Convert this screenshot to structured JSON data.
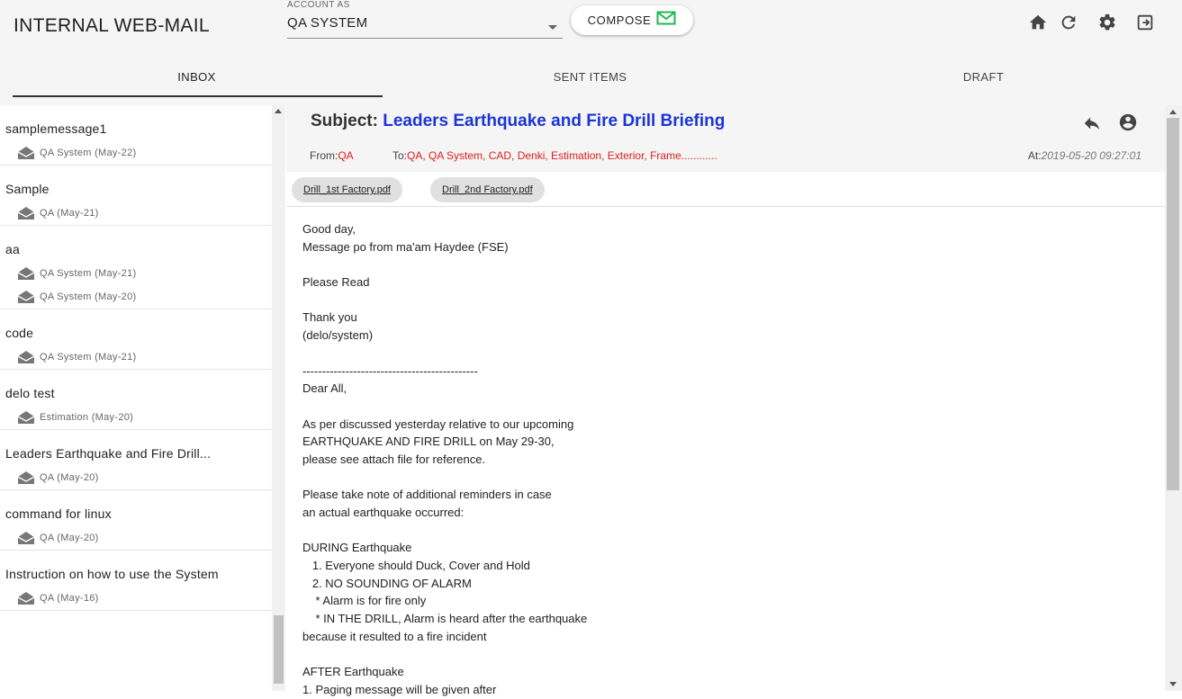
{
  "app": {
    "title": "INTERNAL WEB-MAIL"
  },
  "account": {
    "label": "ACCOUNT AS",
    "value": "QA SYSTEM"
  },
  "compose": {
    "label": "COMPOSE"
  },
  "toolbar_icons": [
    "home-icon",
    "refresh-icon",
    "settings-icon",
    "logout-icon"
  ],
  "tabs": [
    {
      "label": "INBOX",
      "active": true
    },
    {
      "label": "SENT ITEMS",
      "active": false
    },
    {
      "label": "DRAFT",
      "active": false
    }
  ],
  "threads": [
    {
      "subject": "samplemessage1",
      "senders": [
        "QA System (May-22)"
      ]
    },
    {
      "subject": "Sample",
      "senders": [
        "QA (May-21)"
      ]
    },
    {
      "subject": "aa",
      "senders": [
        "QA System (May-21)",
        "QA System (May-20)"
      ]
    },
    {
      "subject": "code",
      "senders": [
        "QA System (May-21)"
      ]
    },
    {
      "subject": "delo test",
      "senders": [
        "Estimation (May-20)"
      ]
    },
    {
      "subject": "Leaders Earthquake and Fire Drill...",
      "senders": [
        "QA (May-20)"
      ]
    },
    {
      "subject": "command for linux",
      "senders": [
        "QA (May-20)"
      ]
    },
    {
      "subject": "Instruction on how to use the System",
      "senders": [
        "QA (May-16)"
      ]
    }
  ],
  "message": {
    "subject_prefix": "Subject:",
    "subject": "Leaders Earthquake and Fire Drill Briefing",
    "from_label": "From:",
    "from": "QA",
    "to_label": "To:",
    "to": "QA, QA System, CAD, Denki, Estimation, Exterior, Frame............",
    "at_label": "At:",
    "at": "2019-05-20 09:27:01",
    "attachments": [
      "Drill_1st Factory.pdf",
      "Drill_2nd Factory.pdf"
    ],
    "body_lines": [
      "Good day,",
      "Message po from ma'am Haydee (FSE)",
      "",
      "Please Read",
      "",
      "Thank you",
      "(delo/system)",
      "",
      "---------------------------------------------",
      "Dear All,",
      "",
      "As per discussed yesterday relative to our upcoming",
      "EARTHQUAKE AND FIRE DRILL on May 29-30,",
      "please see attach file for reference.",
      "",
      "Please take note of additional reminders in case",
      "an actual earthquake occurred:",
      "",
      "DURING Earthquake",
      "   1. Everyone should Duck, Cover and Hold",
      "   2. NO SOUNDING OF ALARM",
      "    * Alarm is for fire only",
      "    * IN THE DRILL, Alarm is heard after the earthquake",
      "because it resulted to a fire incident",
      "",
      "AFTER Earthquake",
      "1. Paging message will be given after"
    ]
  },
  "colors": {
    "accent_blue": "#1a35d6",
    "recipient_red": "#e01b1b",
    "compose_icon_green": "#1db954"
  }
}
